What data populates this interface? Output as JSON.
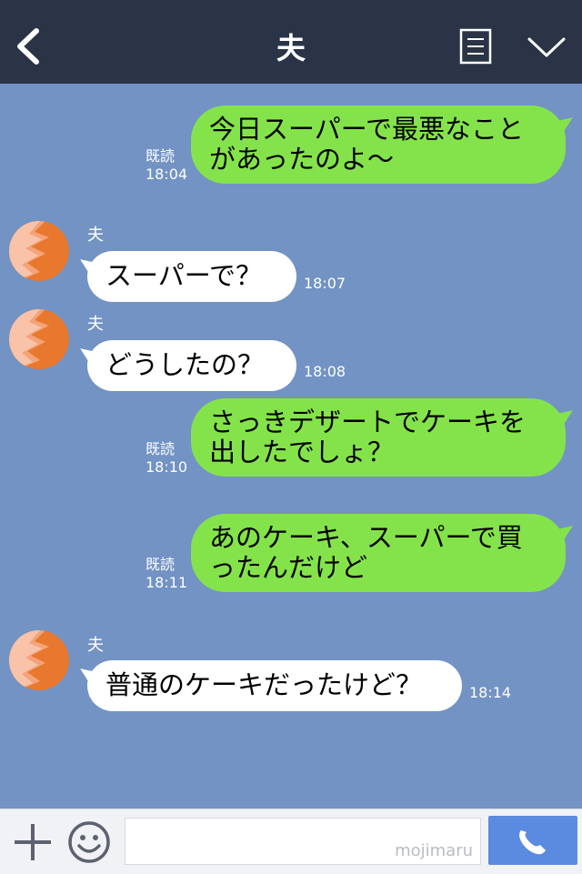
{
  "header": {
    "title": "夫",
    "back_icon": "chevron-left-icon",
    "menu_icon": "menu-list-icon",
    "collapse_icon": "chevron-down-icon"
  },
  "messages": [
    {
      "from": "me",
      "text": "今日スーパーで最悪なこと\nがあったのよ〜",
      "read_label": "既読",
      "time": "18:04"
    },
    {
      "from": "them",
      "sender": "夫",
      "text": "スーパーで？",
      "time": "18:07"
    },
    {
      "from": "them",
      "sender": "夫",
      "text": "どうしたの？",
      "time": "18:08"
    },
    {
      "from": "me",
      "text": "さっきデザートでケーキを\n出したでしょ？",
      "read_label": "既読",
      "time": "18:10"
    },
    {
      "from": "me",
      "text": "あのケーキ、スーパーで買\nったんだけど",
      "read_label": "既読",
      "time": "18:11"
    },
    {
      "from": "them",
      "sender": "夫",
      "text": "普通のケーキだったけど？",
      "time": "18:14"
    }
  ],
  "footer": {
    "plus_icon": "plus-icon",
    "emoji_icon": "smiley-icon",
    "input_value": "",
    "watermark": "mojimaru",
    "call_icon": "phone-icon"
  },
  "colors": {
    "header": "#2a3446",
    "chat_bg": "#7293c4",
    "bubble_me": "#84e34a",
    "bubble_them": "#ffffff",
    "call_button": "#5b8be0"
  }
}
